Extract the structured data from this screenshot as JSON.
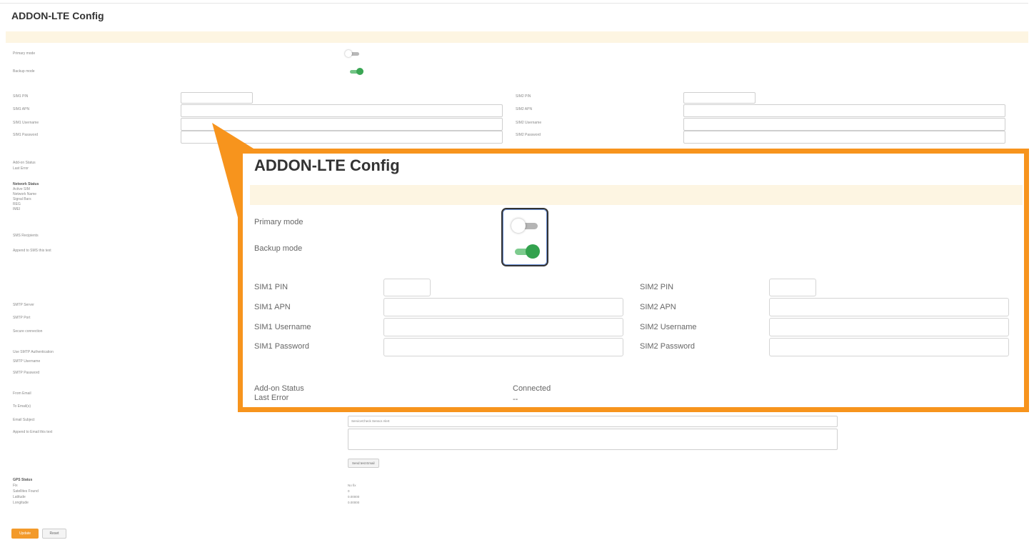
{
  "title": "ADDON-LTE Config",
  "modes": {
    "primary_label": "Primary mode",
    "primary_on": false,
    "backup_label": "Backup mode",
    "backup_on": true
  },
  "sim": {
    "sim1_pin_label": "SIM1 PIN",
    "sim1_apn_label": "SIM1 APN",
    "sim1_username_label": "SIM1 Username",
    "sim1_password_label": "SIM1 Password",
    "sim2_pin_label": "SIM2 PIN",
    "sim2_apn_label": "SIM2 APN",
    "sim2_username_label": "SIM2 Username",
    "sim2_password_label": "SIM2 Password"
  },
  "status": {
    "addon_status_label": "Add-on Status",
    "addon_status_value": "Connected",
    "last_error_label": "Last Error",
    "last_error_value": "--"
  },
  "network": {
    "heading": "Network Status",
    "items": [
      "Active SIM",
      "Network Name",
      "Signal Bars",
      "REG",
      "IMEI"
    ]
  },
  "sms": {
    "recipients_label": "SMS Recipients",
    "append_label": "Append to SMS this text"
  },
  "smtp": {
    "server_label": "SMTP Server",
    "port_label": "SMTP Port",
    "secure_label": "Secure connection",
    "use_auth_label": "Use SMTP Authentication",
    "username_label": "SMTP Username",
    "password_label": "SMTP Password"
  },
  "email": {
    "from_label": "From Email",
    "to_label": "To Email(s)",
    "subject_label": "Email Subject",
    "subject_value": "ServiceCheck Sensor Alert",
    "append_label": "Append to Email this text",
    "send_button": "Send test Email"
  },
  "gps": {
    "heading": "GPS Status",
    "fix_label": "Fix",
    "fix_value": "No fix",
    "satellites_label": "Satellites Found",
    "satellites_value": "0",
    "latitude_label": "Latitude",
    "latitude_value": "0.00000",
    "longitude_label": "Longitude",
    "longitude_value": "0.00000"
  },
  "buttons": {
    "update": "Update",
    "reset": "Reset"
  },
  "colors": {
    "accent": "#f7941d",
    "toggle_on": "#33a24e",
    "banner": "#fdf5e2"
  }
}
